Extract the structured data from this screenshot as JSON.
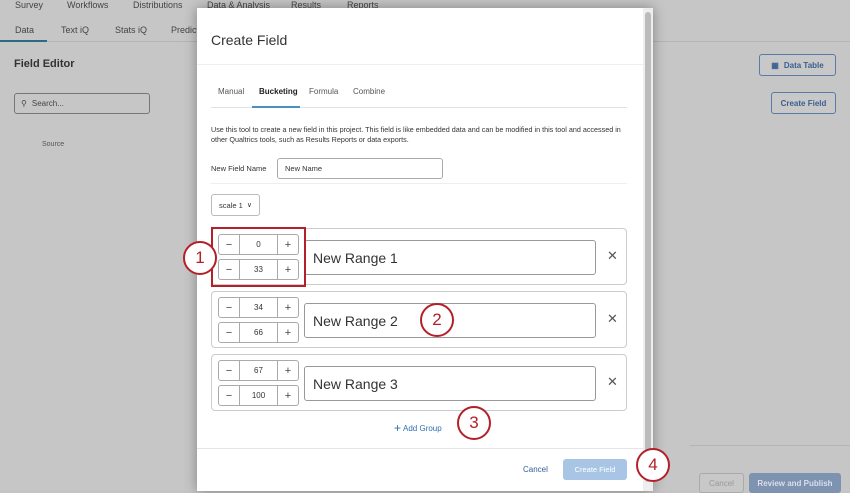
{
  "topnav": [
    "Survey",
    "Workflows",
    "Distributions",
    "Data & Analysis",
    "Results",
    "Reports"
  ],
  "subnav": [
    "Data",
    "Text iQ",
    "Stats iQ",
    "Predict"
  ],
  "page": {
    "title": "Field Editor",
    "search_placeholder": "Search...",
    "column_source": "Source",
    "data_table": "Data Table",
    "create_field": "Create Field",
    "cancel": "Cancel",
    "review_publish": "Review and Publish"
  },
  "modal": {
    "title": "Create Field",
    "tabs": [
      "Manual",
      "Bucketing",
      "Formula",
      "Combine"
    ],
    "active_tab": "Bucketing",
    "description": "Use this tool to create a new field in this project. This field is like embedded data and can be modified in this tool and accessed in other Qualtrics tools, such as Results Reports or data exports.",
    "field_name_label": "New Field Name",
    "field_name_value": "New Name",
    "scale": "scale 1",
    "groups": [
      {
        "min": "0",
        "max": "33",
        "name": "New Range 1"
      },
      {
        "min": "34",
        "max": "66",
        "name": "New Range 2"
      },
      {
        "min": "67",
        "max": "100",
        "name": "New Range 3"
      }
    ],
    "add_group": "Add Group",
    "cancel": "Cancel",
    "create": "Create Field"
  },
  "annotations": [
    "1",
    "2",
    "3",
    "4"
  ]
}
